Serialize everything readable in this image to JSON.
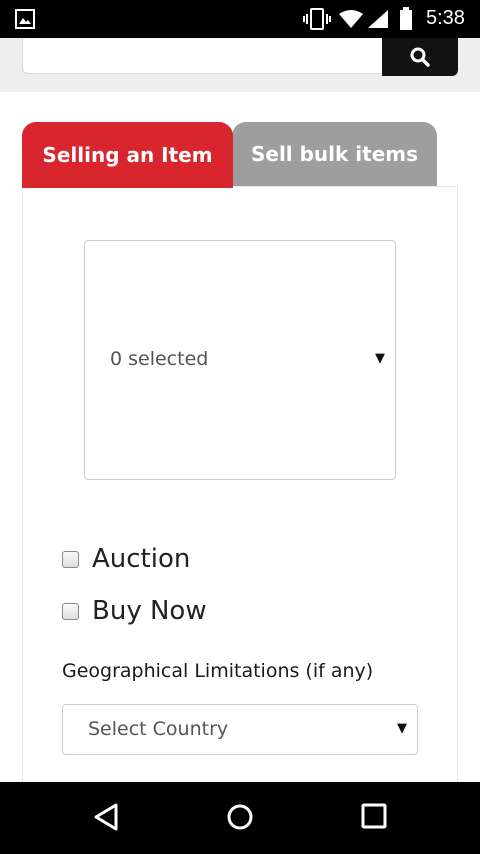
{
  "status_bar": {
    "time": "5:38",
    "icons": [
      "gallery-icon",
      "vibrate-icon",
      "wifi-icon",
      "signal-icon",
      "battery-icon"
    ]
  },
  "search": {
    "value": "",
    "placeholder": "",
    "button_icon": "search-icon"
  },
  "tabs": [
    {
      "label": "Selling an Item",
      "active": true
    },
    {
      "label": "Sell bulk items",
      "active": false
    }
  ],
  "form": {
    "multiselect_value": "0 selected",
    "options": [
      {
        "label": "Auction",
        "checked": false
      },
      {
        "label": "Buy Now",
        "checked": false
      }
    ],
    "geo_label": "Geographical Limitations (if any)",
    "country_select_value": "Select Country"
  },
  "nav_bar": {
    "icons": [
      "back-icon",
      "home-icon",
      "recents-icon"
    ]
  },
  "colors": {
    "accent": "#d9262e",
    "inactive_tab": "#9e9e9e",
    "header_band": "#eeeeee"
  }
}
